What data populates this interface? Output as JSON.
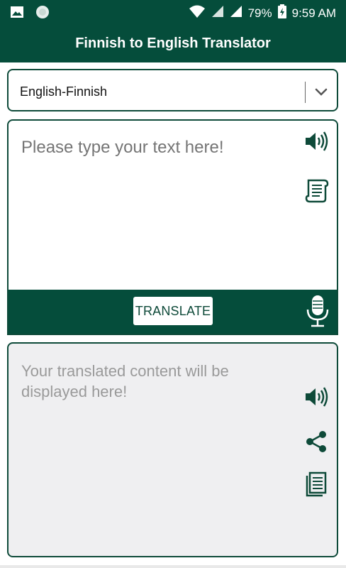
{
  "status_bar": {
    "battery": "79%",
    "time": "9:59 AM",
    "icons": [
      "image-icon",
      "circle-app-icon",
      "wifi-icon",
      "signal-icon",
      "signal-icon",
      "battery-charging-icon"
    ]
  },
  "app_bar": {
    "title": "Finnish to English Translator"
  },
  "language_select": {
    "value": "English-Finnish"
  },
  "input": {
    "placeholder": "Please type your text here!"
  },
  "actions": {
    "translate_label": "TRANSLATE"
  },
  "output": {
    "placeholder": "Your translated content will be displayed here!"
  },
  "colors": {
    "primary": "#054d3b",
    "border": "#0e4a39",
    "placeholder": "#9a9a9a",
    "output_bg": "#efeff1"
  }
}
